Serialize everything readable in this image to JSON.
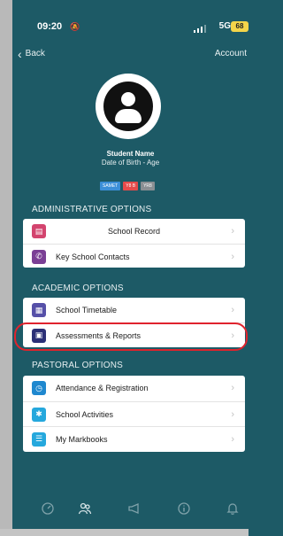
{
  "status_bar": {
    "time": "09:20",
    "network": "5G",
    "battery": "68"
  },
  "nav": {
    "back_label": "Back",
    "account_label": "Account"
  },
  "profile": {
    "name": "Student Name",
    "dob_age": "Date of Birth - Age",
    "badges": [
      "SAMET",
      "Y8 B",
      "YR8"
    ]
  },
  "sections": {
    "admin": {
      "title": "ADMINISTRATIVE OPTIONS",
      "items": [
        {
          "label": "School Record",
          "icon": "record-icon"
        },
        {
          "label": "Key School Contacts",
          "icon": "phone-icon"
        }
      ]
    },
    "academic": {
      "title": "ACADEMIC OPTIONS",
      "items": [
        {
          "label": "School Timetable",
          "icon": "timetable-icon"
        },
        {
          "label": "Assessments & Reports",
          "icon": "clipboard-icon"
        }
      ]
    },
    "pastoral": {
      "title": "PASTORAL OPTIONS",
      "items": [
        {
          "label": "Attendance & Registration",
          "icon": "clock-icon"
        },
        {
          "label": "School Activities",
          "icon": "activity-icon"
        },
        {
          "label": "My Markbooks",
          "icon": "list-icon"
        }
      ]
    }
  },
  "tabbar": [
    "dashboard-icon",
    "people-icon",
    "megaphone-icon",
    "info-icon",
    "bell-icon"
  ],
  "colors": {
    "background": "#1d5a66",
    "highlight": "#e0232d"
  }
}
